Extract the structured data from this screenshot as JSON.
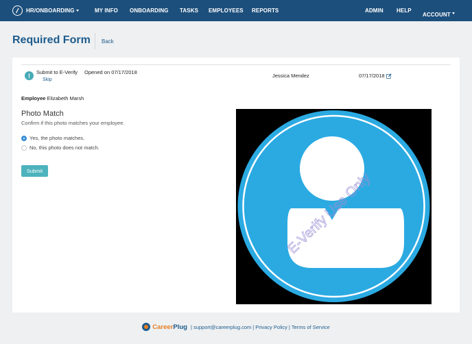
{
  "nav": {
    "brand": "HR/ONBOARDING",
    "items": [
      "MY INFO",
      "ONBOARDING",
      "TASKS",
      "EMPLOYEES",
      "REPORTS"
    ],
    "right": [
      "ADMIN",
      "HELP",
      "ACCOUNT"
    ]
  },
  "header": {
    "title": "Required Form",
    "back": "Back"
  },
  "task": {
    "name": "Submit to E-Verify",
    "skip": "Skip",
    "opened": "Opened on 07/17/2018",
    "assignee": "Jessica Mendez",
    "date": "07/17/2018"
  },
  "employee": {
    "label": "Employee",
    "name": "Elizabeth Marsh"
  },
  "photo_match": {
    "title": "Photo Match",
    "description": "Confirm if this photo matches your employee.",
    "options": [
      "Yes, the photo matches.",
      "No, this photo does not match."
    ],
    "selected_index": 0,
    "submit": "Submit",
    "watermark": "E-Verify Use Only"
  },
  "footer": {
    "brand_career": "Career",
    "brand_plug": "Plug",
    "email": "support@careerplug.com",
    "privacy": "Privacy Policy",
    "terms": "Terms of Service"
  },
  "colors": {
    "nav_bg": "#1d4f7c",
    "accent": "#1d5c8c",
    "teal": "#4db3bd",
    "avatar_blue": "#2baae2"
  }
}
